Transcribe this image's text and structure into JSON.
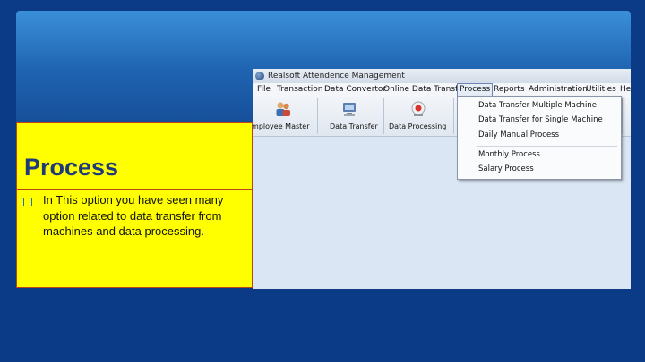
{
  "slide": {
    "title": "Process",
    "bullet": "In This option you have seen many option related to data transfer from machines and data processing."
  },
  "window": {
    "title": "Realsoft Attendence Management",
    "menu": [
      "File",
      "Transaction",
      "Data Convertor",
      "Online Data Transfer",
      "Process",
      "Reports",
      "Administration",
      "Utilities",
      "Help"
    ],
    "active_menu": "Process",
    "toolbar": [
      "Employee Master",
      "Data Transfer",
      "Data Processing"
    ],
    "dropdown": [
      "Data Transfer Multiple Machine",
      "Data Transfer for Single Machine",
      "Daily Manual Process",
      "Monthly Process",
      "Salary Process"
    ]
  },
  "colors": {
    "slide_background": "#0b3a86",
    "panel_background": "#ffff00",
    "panel_title": "#1f3a7a",
    "window_background": "#dbe6f5"
  }
}
